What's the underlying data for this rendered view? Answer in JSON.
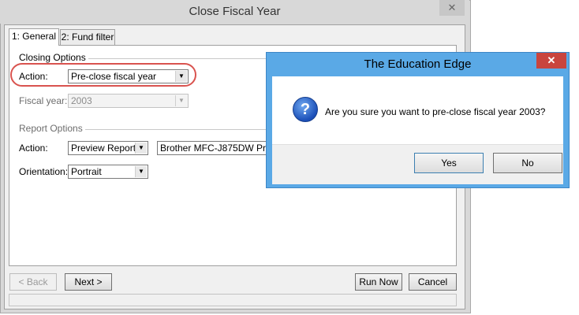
{
  "main_window": {
    "title": "Close Fiscal Year",
    "close_glyph": "✕",
    "tabs": [
      {
        "label": "1: General"
      },
      {
        "label": "2: Fund filter"
      }
    ],
    "closing_options": {
      "group_label": "Closing Options",
      "action_label": "Action:",
      "action_value": "Pre-close fiscal year",
      "fiscal_year_label": "Fiscal year:",
      "fiscal_year_value": "2003"
    },
    "report_options": {
      "group_label": "Report Options",
      "action_label": "Action:",
      "action_value": "Preview Report",
      "printer_value": "Brother MFC-J875DW Printer",
      "orientation_label": "Orientation:",
      "orientation_value": "Portrait"
    },
    "buttons": {
      "back": "< Back",
      "next": "Next >",
      "run_now": "Run Now",
      "cancel": "Cancel"
    }
  },
  "dialog": {
    "title": "The Education Edge",
    "close_glyph": "✕",
    "message": "Are you sure you want to pre-close fiscal year 2003?",
    "icon": "question-icon",
    "icon_glyph": "?",
    "yes_label": "Yes",
    "no_label": "No"
  },
  "colors": {
    "dialog_frame": "#5aa9e6",
    "highlight": "#d9534f",
    "close_button": "#c9453e"
  },
  "combo_arrow_glyph": "▼"
}
